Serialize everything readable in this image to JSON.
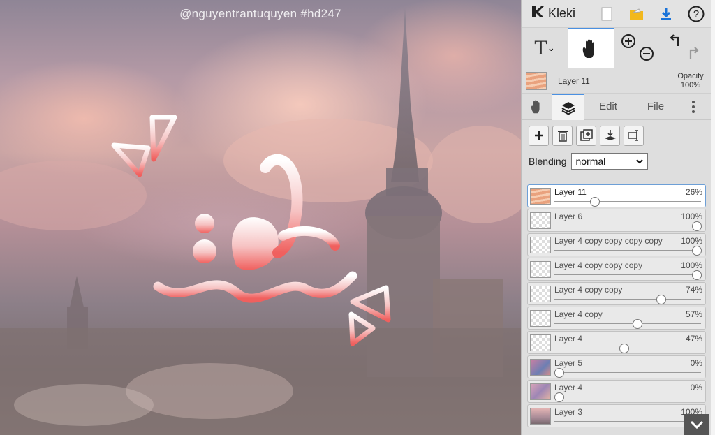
{
  "canvas": {
    "watermark": "@nguyentrantuquyen  #hd247"
  },
  "app": {
    "name": "Kleki"
  },
  "topbar": {
    "icons": [
      "new-file-icon",
      "open-folder-icon",
      "download-icon",
      "help-icon"
    ],
    "help_label": "?"
  },
  "tools": {
    "text_tool": "T",
    "active": "hand"
  },
  "current_layer": {
    "name": "Layer 11",
    "opacity_label": "Opacity",
    "opacity_value": "100%"
  },
  "tabs": {
    "edit": "Edit",
    "file": "File"
  },
  "blending": {
    "label": "Blending",
    "value": "normal"
  },
  "layers": [
    {
      "name": "Layer 11",
      "opacity": "26%",
      "level": 26,
      "thumb": "orange",
      "selected": true
    },
    {
      "name": "Layer 6",
      "opacity": "100%",
      "level": 100,
      "thumb": "empty"
    },
    {
      "name": "Layer 4 copy copy copy copy",
      "opacity": "100%",
      "level": 100,
      "thumb": "empty"
    },
    {
      "name": "Layer 4 copy copy copy",
      "opacity": "100%",
      "level": 100,
      "thumb": "empty"
    },
    {
      "name": "Layer 4 copy copy",
      "opacity": "74%",
      "level": 74,
      "thumb": "empty"
    },
    {
      "name": "Layer 4 copy",
      "opacity": "57%",
      "level": 57,
      "thumb": "empty"
    },
    {
      "name": "Layer 4",
      "opacity": "47%",
      "level": 47,
      "thumb": "empty"
    },
    {
      "name": "Layer 5",
      "opacity": "0%",
      "level": 0,
      "thumb": "pic1"
    },
    {
      "name": "Layer 4",
      "opacity": "0%",
      "level": 0,
      "thumb": "pic2"
    },
    {
      "name": "Layer 3",
      "opacity": "100%",
      "level": 100,
      "thumb": "pic3"
    }
  ],
  "colors": {
    "accent": "#4a90e2"
  }
}
